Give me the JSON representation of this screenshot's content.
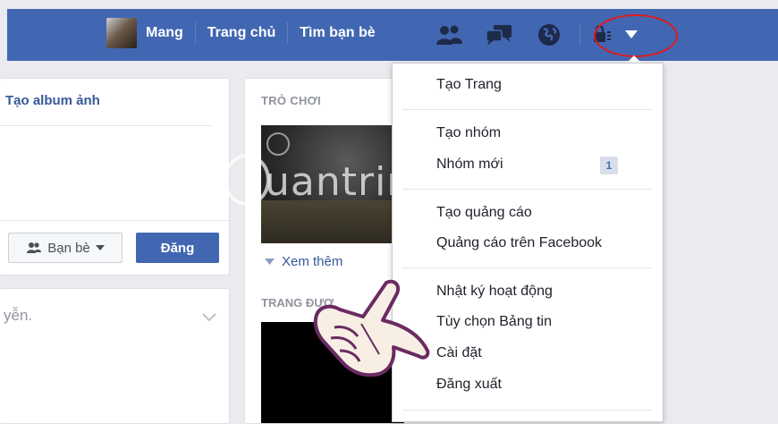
{
  "topbar": {
    "user_name": "Mang",
    "home_label": "Trang chủ",
    "find_friends_label": "Tìm bạn bè",
    "icons": [
      "friend-requests-icon",
      "messages-icon",
      "notifications-globe-icon",
      "privacy-lock-icon",
      "caret-down-icon"
    ],
    "brand_color": "#4267b2",
    "highlight_color": "#e01a1a"
  },
  "left_card": {
    "create_album": "Tạo album ảnh",
    "audience_label": "Bạn bè",
    "post_label": "Đăng"
  },
  "left_bottom_card": {
    "snippet": "yễn."
  },
  "games_card": {
    "title": "TRÒ CHƠI",
    "see_more": "Xem thêm",
    "pages_title": "TRANG ĐƯỢ"
  },
  "watermark": {
    "text": "uantrimang"
  },
  "menu": {
    "items": [
      {
        "label": "Tạo Trang"
      },
      {
        "label": "Tạo nhóm"
      },
      {
        "label": "Nhóm mới",
        "badge": "1"
      },
      {
        "label": "Tạo quảng cáo"
      },
      {
        "label": "Quảng cáo trên Facebook"
      },
      {
        "label": "Nhật ký hoạt động"
      },
      {
        "label": "Tùy chọn Bảng tin"
      },
      {
        "label": "Cài đặt"
      },
      {
        "label": "Đăng xuất"
      }
    ]
  }
}
